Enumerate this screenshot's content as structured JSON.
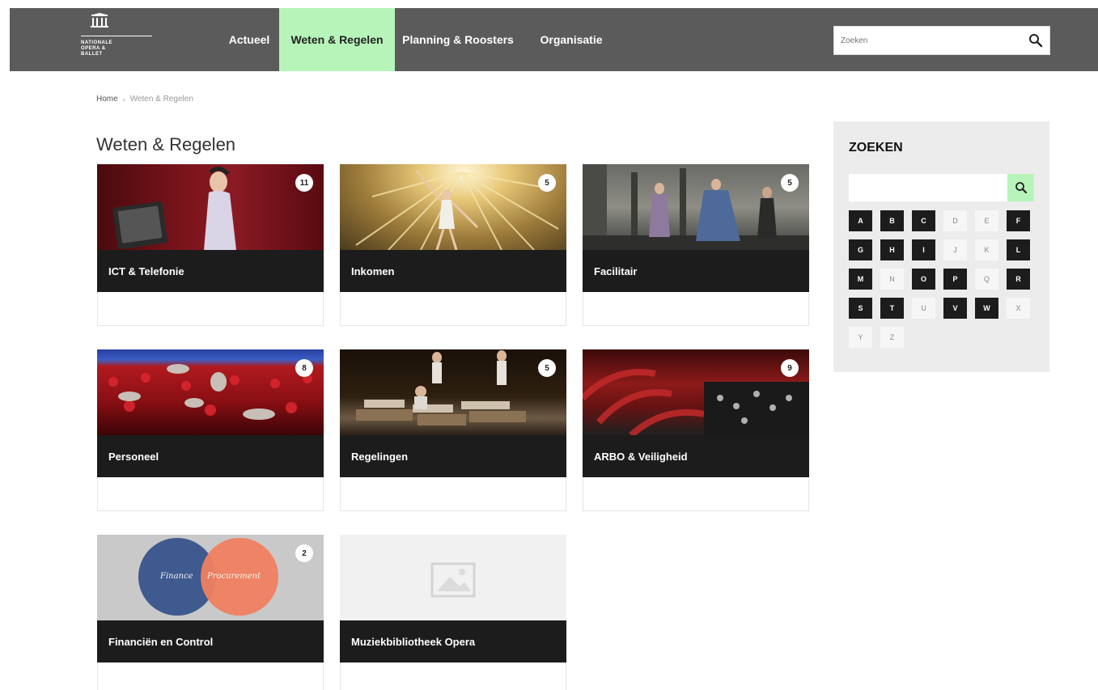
{
  "logo": {
    "lines": [
      "NATIONALE",
      "OPERA &",
      "BALLET"
    ],
    "icon": "building-icon"
  },
  "nav": {
    "items": [
      {
        "label": "Actueel",
        "active": false
      },
      {
        "label": "Weten & Regelen",
        "active": true
      },
      {
        "label": "Planning & Roosters",
        "active": false
      },
      {
        "label": "Organisatie",
        "active": false
      }
    ]
  },
  "search": {
    "placeholder": "Zoeken",
    "icon": "search-icon"
  },
  "breadcrumb": {
    "home": "Home",
    "separator": "›",
    "current": "Weten & Regelen"
  },
  "page": {
    "title": "Weten & Regelen"
  },
  "cards": [
    {
      "title": "ICT & Telefonie",
      "count": "11"
    },
    {
      "title": "Inkomen",
      "count": "5"
    },
    {
      "title": "Facilitair",
      "count": "5"
    },
    {
      "title": "Personeel",
      "count": "8"
    },
    {
      "title": "Regelingen",
      "count": "5"
    },
    {
      "title": "ARBO & Veiligheid",
      "count": "9"
    },
    {
      "title": "Financiën en Control",
      "count": "2",
      "image_text": [
        "Finance",
        "Procurement"
      ]
    },
    {
      "title": "Muziekbibliotheek Opera",
      "count": ""
    }
  ],
  "sidebar": {
    "title": "ZOEKEN",
    "input_value": "",
    "button_icon": "search-icon",
    "letters": [
      {
        "l": "A",
        "on": true
      },
      {
        "l": "B",
        "on": true
      },
      {
        "l": "C",
        "on": true
      },
      {
        "l": "D",
        "on": false
      },
      {
        "l": "E",
        "on": false
      },
      {
        "l": "F",
        "on": true
      },
      {
        "l": "G",
        "on": true
      },
      {
        "l": "H",
        "on": true
      },
      {
        "l": "I",
        "on": true
      },
      {
        "l": "J",
        "on": false
      },
      {
        "l": "K",
        "on": false
      },
      {
        "l": "L",
        "on": true
      },
      {
        "l": "M",
        "on": true
      },
      {
        "l": "N",
        "on": false
      },
      {
        "l": "O",
        "on": true
      },
      {
        "l": "P",
        "on": true
      },
      {
        "l": "Q",
        "on": false
      },
      {
        "l": "R",
        "on": true
      },
      {
        "l": "S",
        "on": true
      },
      {
        "l": "T",
        "on": true
      },
      {
        "l": "U",
        "on": false
      },
      {
        "l": "V",
        "on": true
      },
      {
        "l": "W",
        "on": true
      },
      {
        "l": "X",
        "on": false
      },
      {
        "l": "Y",
        "on": false
      },
      {
        "l": "Z",
        "on": false
      }
    ]
  },
  "colors": {
    "topbar": "#5b5b5b",
    "accent": "#b7f4b9",
    "card_bar": "#1c1c1c",
    "panel": "#ececec"
  }
}
